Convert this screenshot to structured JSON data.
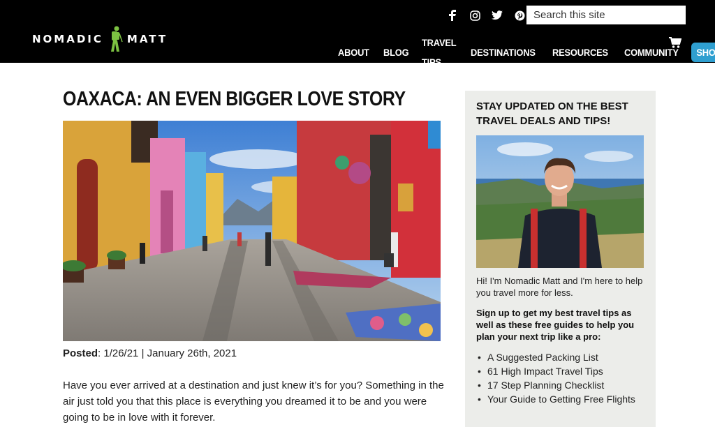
{
  "header": {
    "logo_left": "NOMADIC",
    "logo_right": "MATT",
    "search_placeholder": "Search this site",
    "social_icons": [
      "facebook-icon",
      "instagram-icon",
      "twitter-icon",
      "pinterest-icon"
    ],
    "nav": [
      "ABOUT",
      "BLOG",
      "TRAVEL TIPS",
      "DESTINATIONS",
      "RESOURCES",
      "COMMUNITY"
    ],
    "shop_label": "SHOP",
    "accent_color": "#2f9fd0"
  },
  "article": {
    "title": "OAXACA: AN EVEN BIGGER LOVE STORY",
    "posted_label": "Posted",
    "posted_value": ": 1/26/21 | January 26th, 2021",
    "intro": "Have you ever arrived at a destination and just knew it’s for you? Something in the air just told you that this place is everything you dreamed it to be and you were going to be in love with it forever."
  },
  "sidebar": {
    "title": "STAY UPDATED ON THE BEST TRAVEL DEALS AND TIPS!",
    "intro": "Hi! I'm Nomadic Matt and I'm here to help you travel more for less.",
    "signup": "Sign up to get my best travel tips as well as these free guides to help you plan your next trip like a pro:",
    "guides": [
      "A Suggested Packing List",
      "61 High Impact Travel Tips",
      "17 Step Planning Checklist",
      "Your Guide to Getting Free Flights"
    ]
  }
}
